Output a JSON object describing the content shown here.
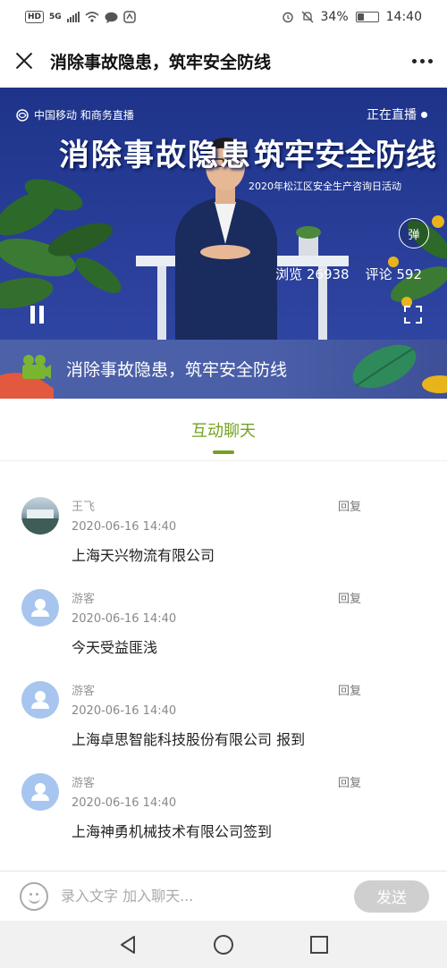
{
  "status_bar": {
    "left_badges": [
      "HD",
      "5G"
    ],
    "battery_percent": "34%",
    "battery_level": 0.34,
    "time": "14:40",
    "icons": [
      "alarm-icon",
      "mute-icon",
      "battery-icon"
    ]
  },
  "header": {
    "title": "消除事故隐患，筑牢安全防线",
    "close_icon": "close-icon",
    "more_icon": "more-icon"
  },
  "video": {
    "live_status": "正在直播",
    "brand_label": "中国移动 和商务直播",
    "banner_left": "消除事故隐患",
    "banner_right": "筑牢安全防线",
    "event_line": "2020年松江区安全生产咨询日活动",
    "views_label": "浏览 26938",
    "comments_label": "评论 592",
    "danmu_label": "弹"
  },
  "strip": {
    "title": "消除事故隐患，筑牢安全防线"
  },
  "tabs": {
    "active": "互动聊天"
  },
  "chat": {
    "reply_label": "回复",
    "messages": [
      {
        "name": "王飞",
        "time": "2020-06-16 14:40",
        "content": "上海天兴物流有限公司",
        "avatar": "photo"
      },
      {
        "name": "游客",
        "time": "2020-06-16 14:40",
        "content": "今天受益匪浅",
        "avatar": "guest"
      },
      {
        "name": "游客",
        "time": "2020-06-16 14:40",
        "content": "上海卓思智能科技股份有限公司 报到",
        "avatar": "guest"
      },
      {
        "name": "游客",
        "time": "2020-06-16 14:40",
        "content": "上海神勇机械技术有限公司签到",
        "avatar": "guest"
      }
    ]
  },
  "input": {
    "placeholder": "录入文字 加入聊天...",
    "send_label": "发送"
  },
  "colors": {
    "accent_green": "#74a21e",
    "video_blue": "#263f9c",
    "guest_avatar": "#a7c5ee"
  }
}
